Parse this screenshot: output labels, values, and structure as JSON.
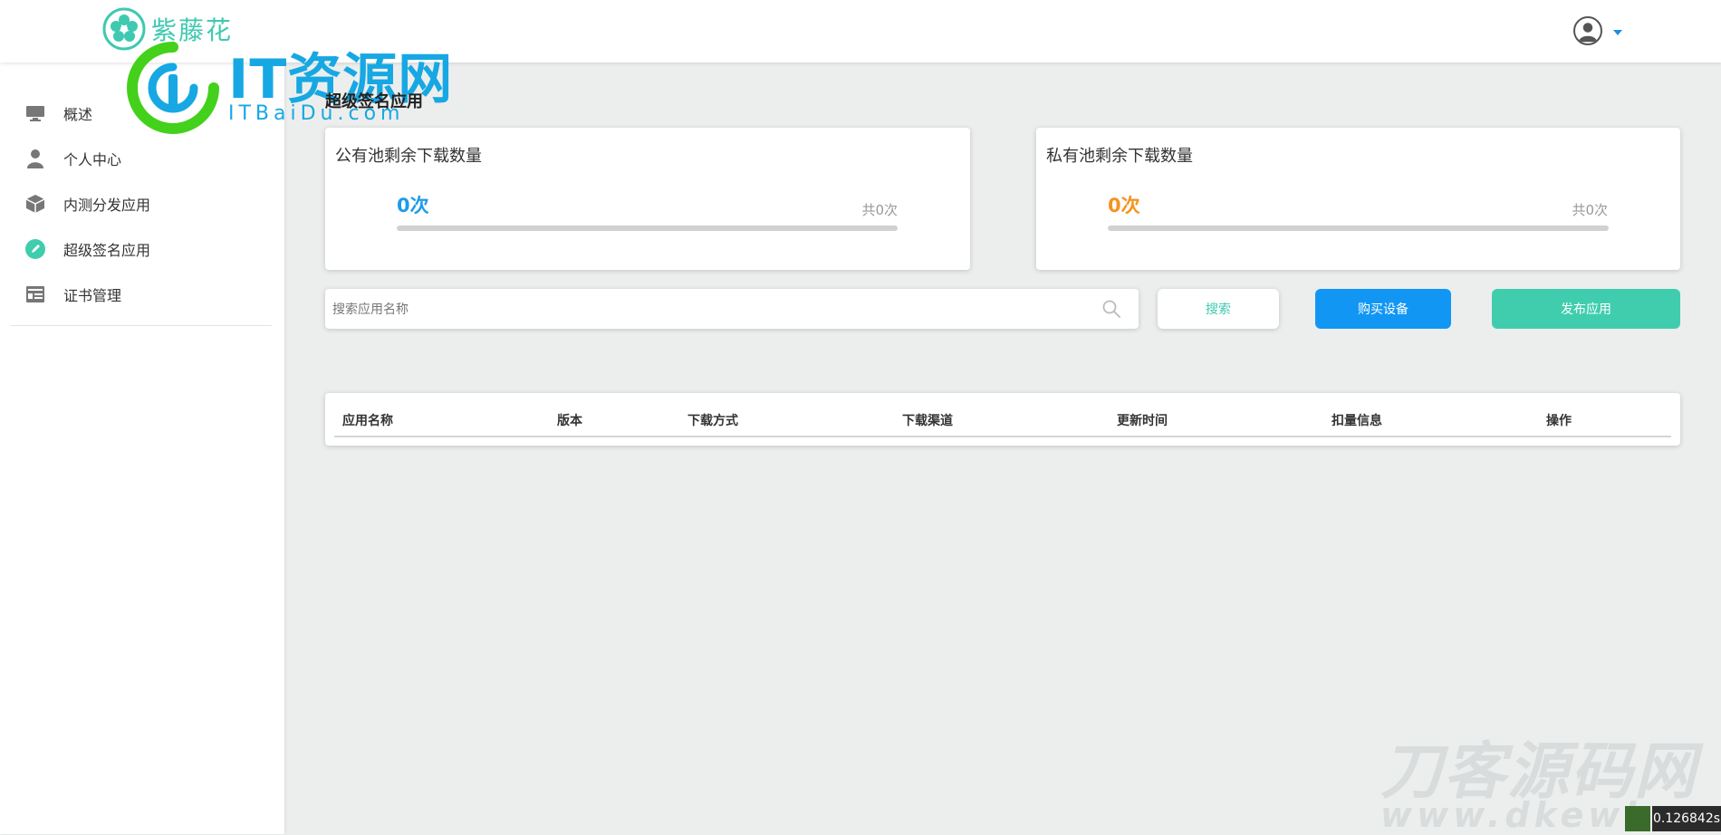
{
  "brand": {
    "name": "紫藤花"
  },
  "watermark": {
    "title": "IT资源网",
    "subtitle": "ITBaiDu.com"
  },
  "header": {
    "user_menu": "user-avatar"
  },
  "sidebar": {
    "items": [
      {
        "label": "概述",
        "icon": "monitor-icon"
      },
      {
        "label": "个人中心",
        "icon": "user-icon"
      },
      {
        "label": "内测分发应用",
        "icon": "package-icon"
      },
      {
        "label": "超级签名应用",
        "icon": "edit-circle-icon"
      },
      {
        "label": "证书管理",
        "icon": "certificate-icon"
      }
    ]
  },
  "page": {
    "title": "超级签名应用"
  },
  "pools": {
    "public": {
      "title": "公有池剩余下载数量",
      "value": "0次",
      "total": "共0次",
      "fraction": 0,
      "color": "#1e9be9"
    },
    "private": {
      "title": "私有池剩余下载数量",
      "value": "0次",
      "total": "共0次",
      "fraction": 0,
      "color": "#f6921e"
    }
  },
  "search": {
    "placeholder": "搜索应用名称",
    "value": ""
  },
  "buttons": {
    "search": "搜索",
    "buy": "购买设备",
    "publish": "发布应用"
  },
  "table": {
    "columns": [
      "应用名称",
      "版本",
      "下载方式",
      "下载渠道",
      "更新时间",
      "扣量信息",
      "操作"
    ],
    "rows": []
  },
  "corner_watermark": {
    "title": "刀客源码网",
    "url": "www.dkewl.com"
  },
  "timer": {
    "text": "0.126842s"
  },
  "colors": {
    "accent": "#40cdae",
    "primary": "#1296f4",
    "background": "#eceeee"
  }
}
